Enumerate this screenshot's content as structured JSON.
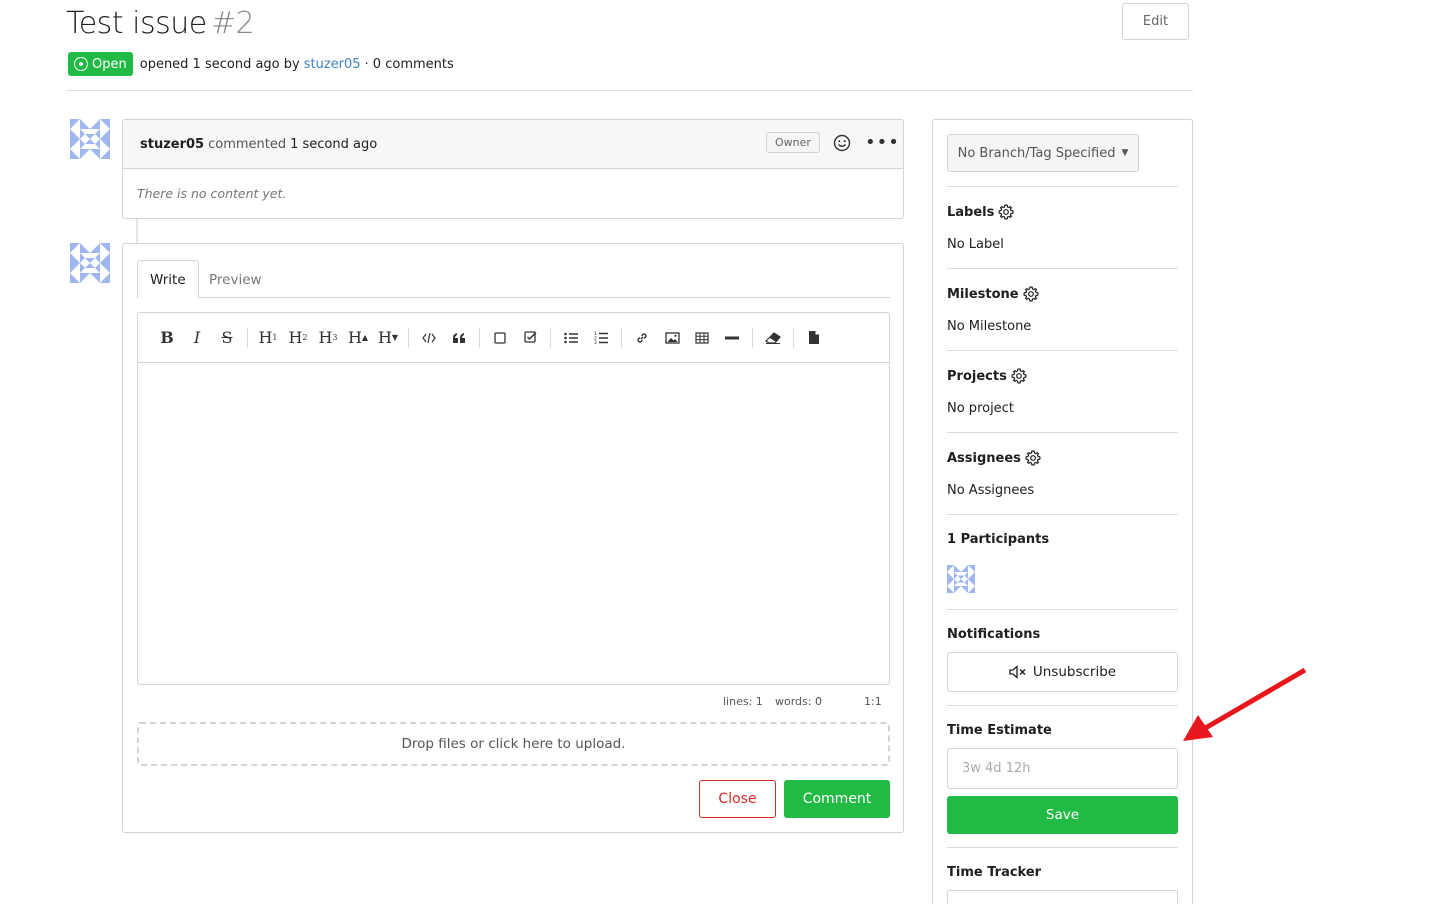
{
  "issue": {
    "title": "Test issue",
    "number": "#2",
    "edit_label": "Edit",
    "status": "Open",
    "opened_text": "opened 1 second ago by",
    "author": "stuzer05",
    "comments_text": "· 0 comments"
  },
  "comment": {
    "author": "stuzer05",
    "action": "commented",
    "time": "1 second ago",
    "role": "Owner",
    "empty_text": "There is no content yet."
  },
  "form": {
    "tabs": [
      "Write",
      "Preview"
    ],
    "status": {
      "lines": "lines: 1",
      "words": "words: 0",
      "cursor": "1:1"
    },
    "dropzone": "Drop files or click here to upload.",
    "close_label": "Close",
    "comment_label": "Comment"
  },
  "sidebar": {
    "branch_label": "No Branch/Tag Specified",
    "labels": {
      "title": "Labels",
      "value": "No Label"
    },
    "milestone": {
      "title": "Milestone",
      "value": "No Milestone"
    },
    "projects": {
      "title": "Projects",
      "value": "No project"
    },
    "assignees": {
      "title": "Assignees",
      "value": "No Assignees"
    },
    "participants": {
      "title": "1 Participants"
    },
    "notifications": {
      "title": "Notifications",
      "button": "Unsubscribe"
    },
    "time_estimate": {
      "title": "Time Estimate",
      "placeholder": "3w 4d 12h",
      "save": "Save"
    },
    "time_tracker": {
      "title": "Time Tracker"
    }
  },
  "colors": {
    "green": "#21ba45",
    "red": "#db2828",
    "link": "#4183c4",
    "annotation_arrow": "#e8171e"
  }
}
